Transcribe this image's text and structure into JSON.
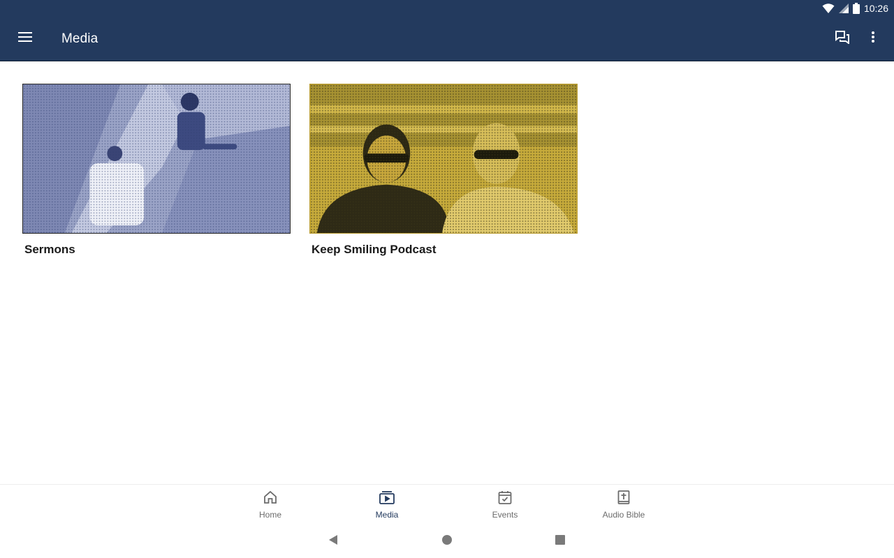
{
  "status_bar": {
    "time": "10:26",
    "icons": [
      "wifi-icon",
      "cell-signal-icon",
      "battery-icon"
    ]
  },
  "app_bar": {
    "title": "Media",
    "icons": [
      "menu-icon",
      "chat-icon",
      "more-vertical-icon"
    ]
  },
  "media_cards": [
    {
      "title": "Sermons"
    },
    {
      "title": "Keep Smiling Podcast"
    }
  ],
  "bottom_nav": {
    "items": [
      {
        "label": "Home",
        "icon": "home-icon"
      },
      {
        "label": "Media",
        "icon": "media-icon"
      },
      {
        "label": "Events",
        "icon": "calendar-icon"
      },
      {
        "label": "Audio Bible",
        "icon": "bible-icon"
      }
    ],
    "active": "Media"
  },
  "colors": {
    "app_bar": "#233a5e",
    "sermons_tint": "#a9b1d1",
    "podcast_tint": "#c9ae3c"
  }
}
